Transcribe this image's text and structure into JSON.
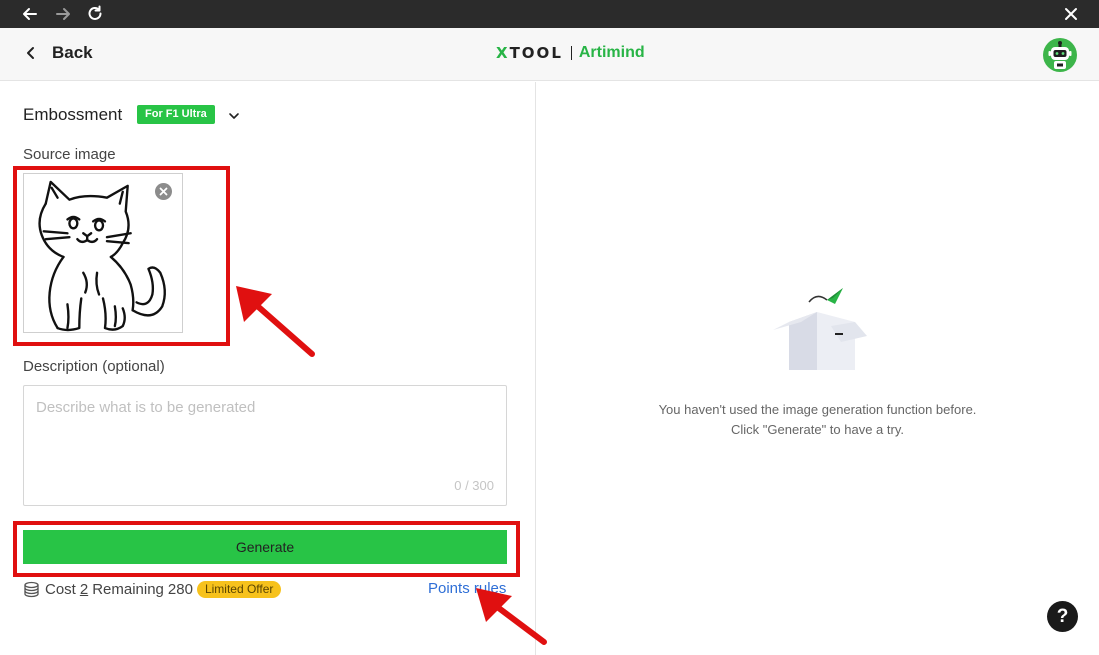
{
  "titlebar": {
    "back_icon": "arrow-left-icon",
    "forward_icon": "arrow-right-icon",
    "reload_icon": "reload-icon",
    "close_icon": "close-icon"
  },
  "header": {
    "back_label": "Back",
    "brand_logo_x": "X",
    "brand_logo_rest": "TOOL",
    "brand_name": "Artimind",
    "avatar_icon": "robot-avatar-icon"
  },
  "left": {
    "mode_title": "Embossment",
    "mode_badge": "For F1 Ultra",
    "source_label": "Source image",
    "description_label": "Description (optional)",
    "description_placeholder": "Describe what is to be generated",
    "description_value": "",
    "description_count": "0 / 300",
    "generate_label": "Generate",
    "cost_label": "Cost",
    "cost_value": "2",
    "remaining_label": "Remaining",
    "remaining_value": "280",
    "offer_badge": "Limited Offer",
    "points_rules_label": "Points rules"
  },
  "right": {
    "empty_line1": "You haven't used the image generation function before.",
    "empty_line2": "Click \"Generate\" to have a try.",
    "help_label": "?"
  },
  "colors": {
    "accent_green": "#28c446",
    "brand_green": "#28b446",
    "link_blue": "#2f6fd6",
    "highlight_red": "#e01010",
    "offer_yellow": "#f7c21c"
  }
}
